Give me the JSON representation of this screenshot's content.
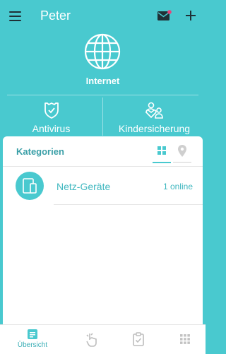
{
  "header": {
    "title": "Peter"
  },
  "internet": {
    "label": "Internet"
  },
  "features": [
    {
      "label": "Antivirus"
    },
    {
      "label": "Kindersicherung"
    }
  ],
  "categories": {
    "title": "Kategorien",
    "devices": [
      {
        "label": "Netz-Geräte",
        "status": "1 online"
      }
    ]
  },
  "bottom_nav": {
    "items": [
      {
        "label": "Übersicht",
        "icon": "overview-icon",
        "active": true
      },
      {
        "label": "",
        "icon": "touch-icon",
        "active": false
      },
      {
        "label": "",
        "icon": "clipboard-check-icon",
        "active": false
      },
      {
        "label": "",
        "icon": "apps-grid-icon",
        "active": false
      }
    ]
  },
  "colors": {
    "accent": "#49c9cf",
    "accent_text": "#3a9fa7",
    "notification": "#e8417a"
  }
}
